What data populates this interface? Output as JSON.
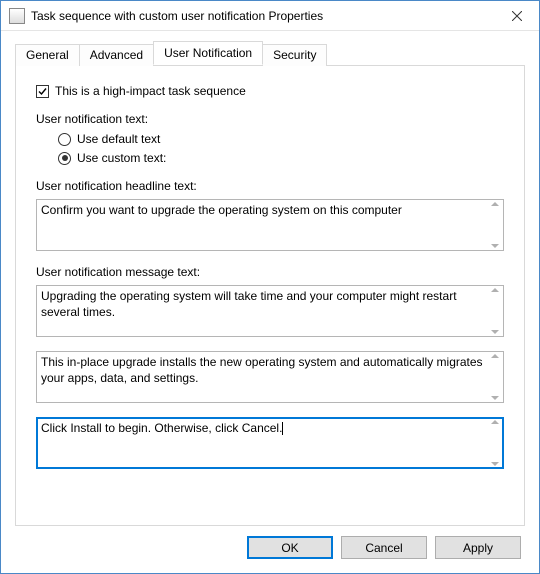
{
  "window": {
    "title": "Task sequence with custom user notification Properties"
  },
  "tabs": {
    "general": "General",
    "advanced": "Advanced",
    "user_notification": "User Notification",
    "security": "Security",
    "active": "user_notification"
  },
  "panel": {
    "high_impact_checkbox_label": "This is a high-impact task sequence",
    "high_impact_checked": true,
    "notification_text_label": "User notification text:",
    "radio_default": "Use default text",
    "radio_custom": "Use custom text:",
    "radio_selected": "custom",
    "headline_label": "User notification headline text:",
    "headline_value": "Confirm you want to upgrade the operating system on this computer",
    "message_label": "User notification message text:",
    "message1_value": "Upgrading the operating system will take time and your computer might restart several times.",
    "message2_value": "This in-place upgrade installs the new operating system and automatically migrates your apps, data, and settings.",
    "message3_value": "Click Install to begin. Otherwise, click Cancel."
  },
  "buttons": {
    "ok": "OK",
    "cancel": "Cancel",
    "apply": "Apply"
  }
}
